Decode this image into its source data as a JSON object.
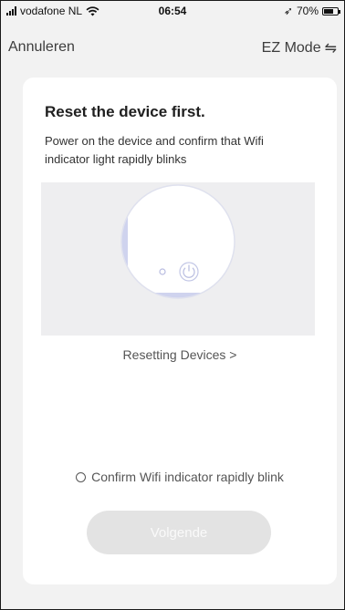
{
  "status_bar": {
    "carrier": "vodafone NL",
    "time": "06:54",
    "location_glyph": "➶",
    "battery_percent_text": "70%",
    "battery_level": 0.7
  },
  "nav": {
    "cancel_label": "Annuleren",
    "mode_label": "EZ Mode",
    "mode_icon": "⇋"
  },
  "card": {
    "title": "Reset the device first.",
    "description": "Power on the device and confirm that Wifi indicator light rapidly blinks",
    "reset_link": "Resetting Devices >",
    "confirm_label": "Confirm Wifi indicator rapidly blink",
    "next_button": "Volgende"
  },
  "colors": {
    "background": "#f2f2f2",
    "card": "#ffffff",
    "button_disabled": "#e3e3e3",
    "illustration_bg": "#eeeef0",
    "device_accent": "#cfd3ee"
  },
  "icons": [
    "signal-icon",
    "wifi-icon",
    "location-arrow-icon",
    "battery-icon",
    "swap-icon",
    "power-icon",
    "radio-icon"
  ]
}
